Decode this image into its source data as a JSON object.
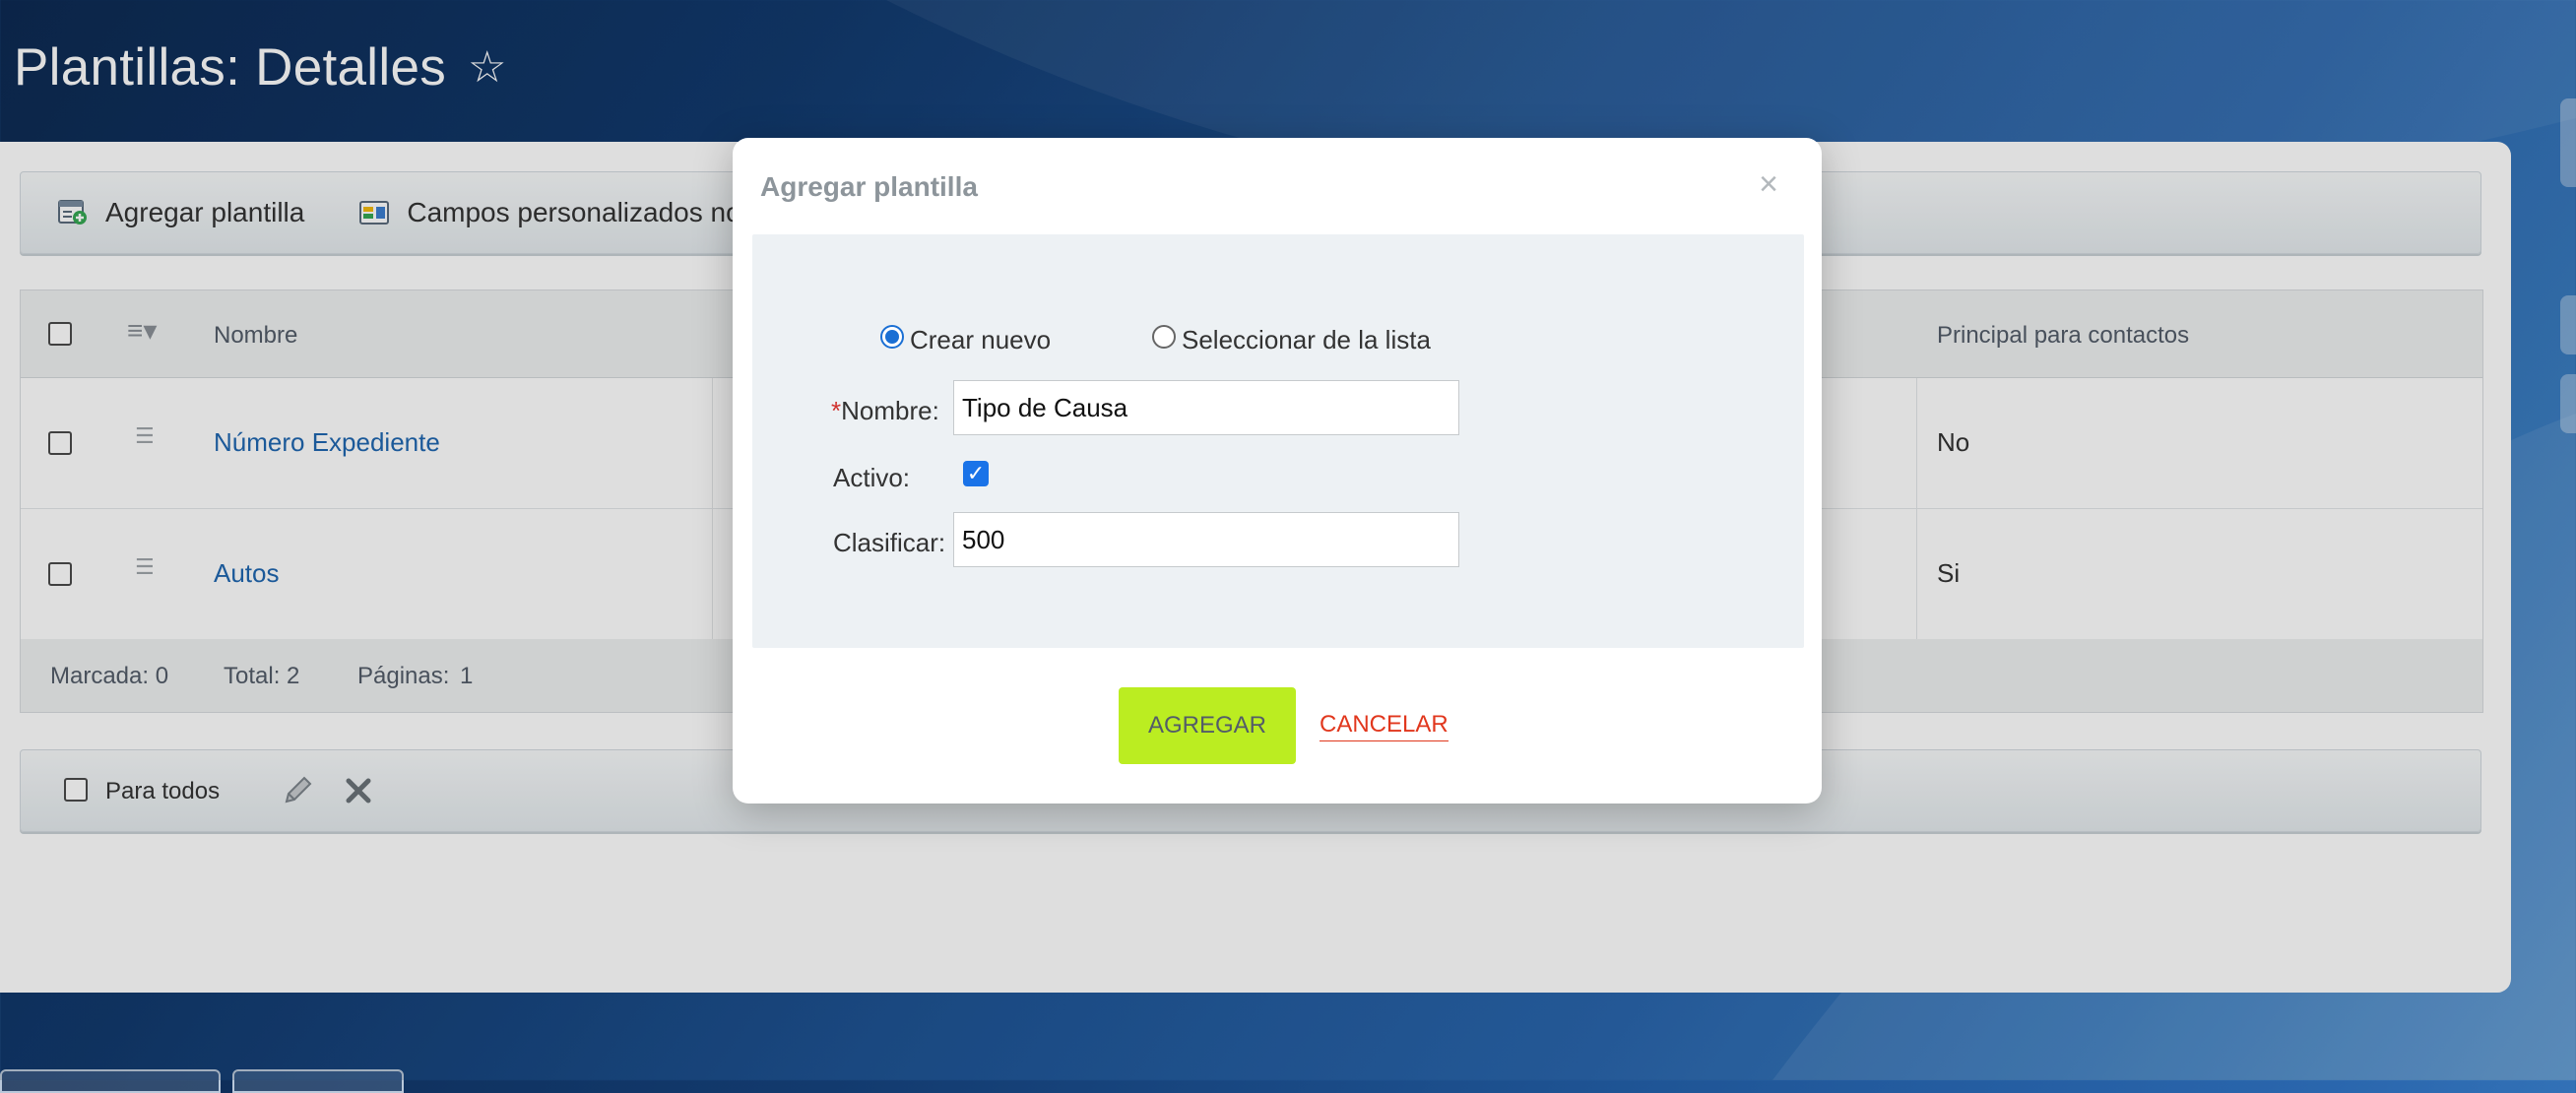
{
  "page": {
    "title": "Plantillas: Detalles"
  },
  "toolbar": {
    "add_template": "Agregar plantilla",
    "custom_fields": "Campos personalizados no"
  },
  "grid": {
    "columns": {
      "name": "Nombre",
      "principal": "Principal para contactos"
    },
    "rows": [
      {
        "name": "Número Expediente",
        "principal": "No"
      },
      {
        "name": "Autos",
        "principal": "Si"
      }
    ],
    "footer": {
      "marked": "Marcada: 0",
      "total": "Total: 2",
      "pages_label": "Páginas:",
      "pages_value": "1"
    }
  },
  "actions": {
    "for_all": "Para todos"
  },
  "modal": {
    "title": "Agregar plantilla",
    "close": "×",
    "radio_new": "Crear nuevo",
    "radio_list": "Seleccionar de la lista",
    "name_required_mark": "*",
    "name_label": "Nombre:",
    "name_value": "Tipo de Causa",
    "active_label": "Activo:",
    "sort_label": "Clasificar:",
    "sort_value": "500",
    "add_button": "AGREGAR",
    "cancel_button": "CANCELAR"
  },
  "icons": {
    "star": "star-outline-icon",
    "edit": "pencil-icon",
    "delete": "cross-icon"
  },
  "colors": {
    "link": "#2067b0",
    "primary_button": "#bbed21",
    "cancel_link": "#e1371d",
    "checkbox_checked": "#1a73e8"
  }
}
